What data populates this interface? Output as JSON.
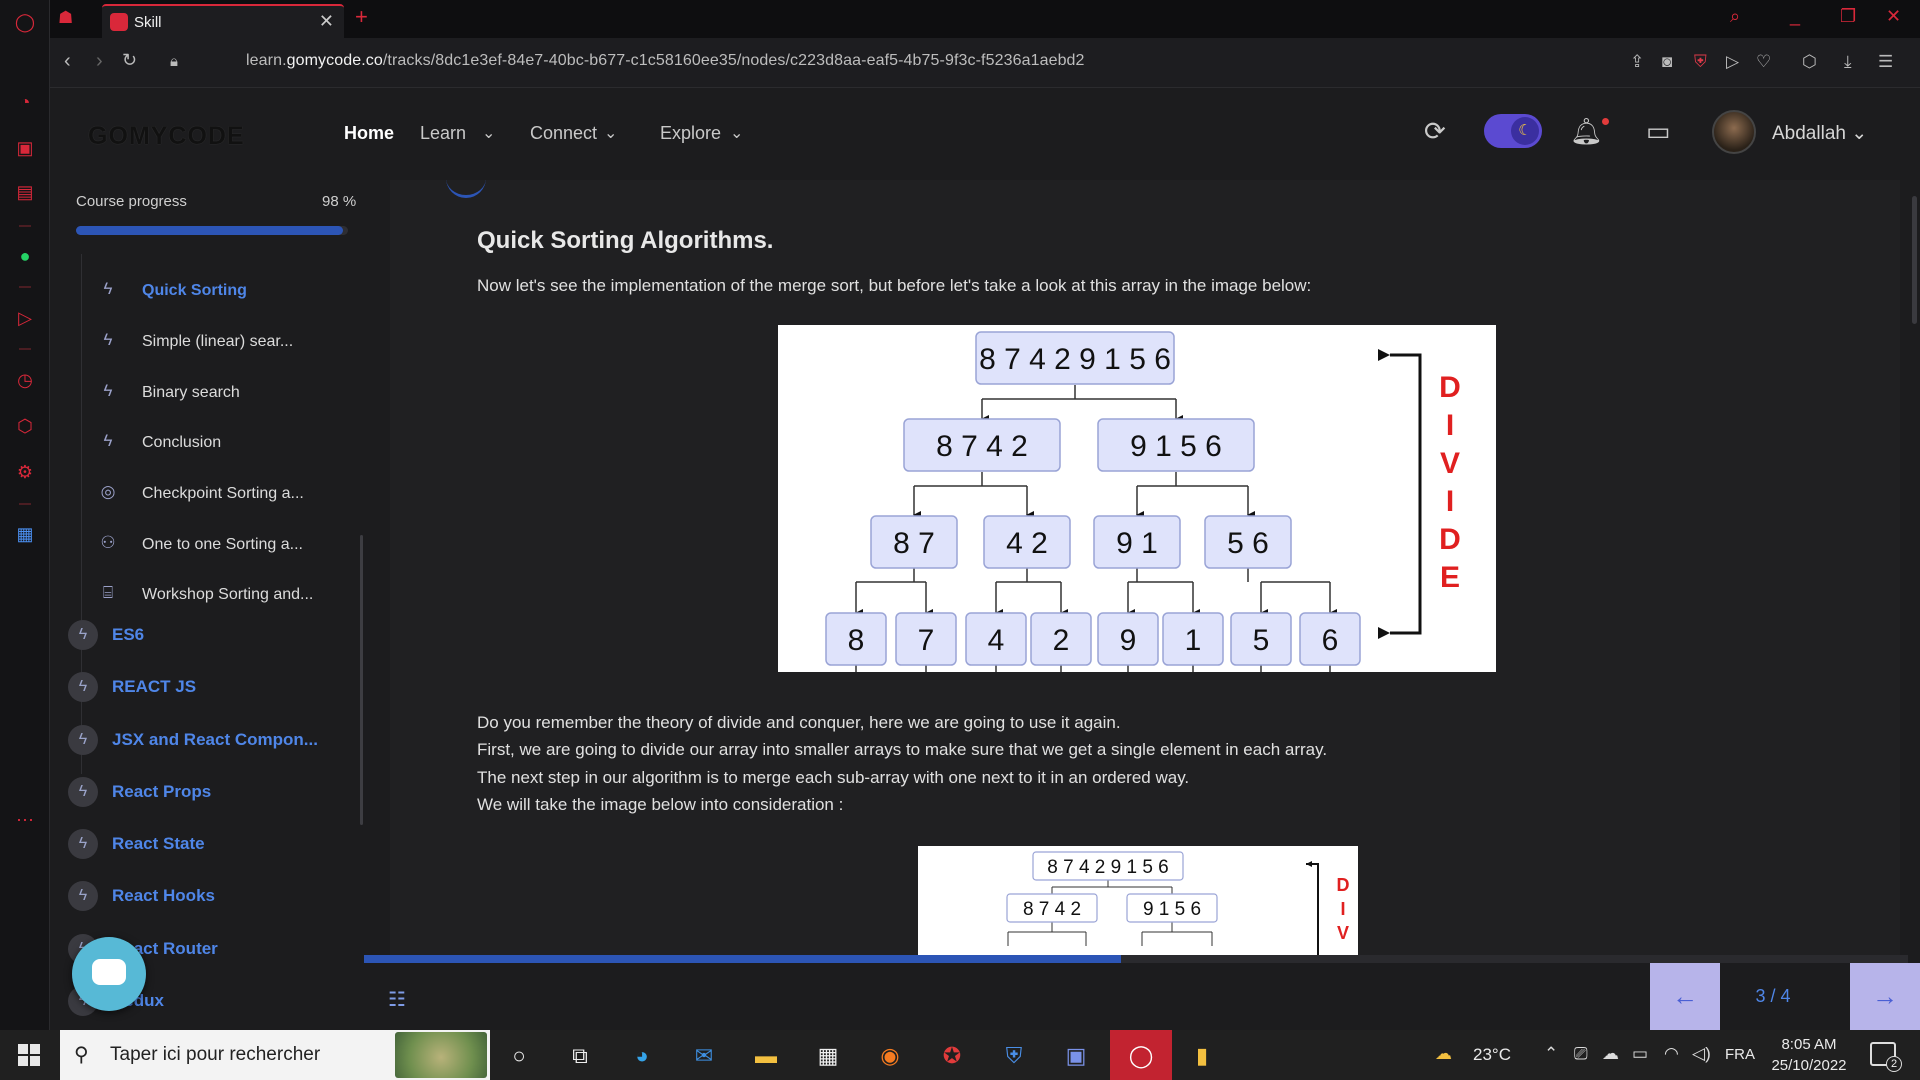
{
  "browser": {
    "tab_title": "Skill",
    "url_prefix": "learn.",
    "url_domain": "gomycode.co",
    "url_path": "/tracks/8dc1e3ef-84e7-40bc-b677-c1c58160ee35/nodes/c223d8aa-eaf5-4b75-9f3c-f5236a1aebd2"
  },
  "header": {
    "logo": "GOMYCODE",
    "nav": [
      {
        "label": "Home",
        "active": true
      },
      {
        "label": "Learn"
      },
      {
        "label": "Connect"
      },
      {
        "label": "Explore"
      }
    ],
    "username": "Abdallah"
  },
  "sidebar": {
    "progress_label": "Course progress",
    "progress_value": "98 %",
    "progress_fraction": 0.98,
    "lessons": [
      {
        "label": "Quick Sorting",
        "icon": "bolt-icon",
        "active": true
      },
      {
        "label": "Simple (linear) sear...",
        "icon": "bolt-icon"
      },
      {
        "label": "Binary search",
        "icon": "bolt-icon"
      },
      {
        "label": "Conclusion",
        "icon": "bolt-icon"
      },
      {
        "label": "Checkpoint Sorting a...",
        "icon": "target-icon"
      },
      {
        "label": "One to one Sorting a...",
        "icon": "people-icon"
      },
      {
        "label": "Workshop Sorting and...",
        "icon": "workshop-icon",
        "alert": true
      }
    ],
    "modules": [
      {
        "label": "ES6"
      },
      {
        "label": "REACT JS"
      },
      {
        "label": "JSX and React Compon..."
      },
      {
        "label": "React Props"
      },
      {
        "label": "React State"
      },
      {
        "label": "React Hooks"
      },
      {
        "label": "React Router"
      },
      {
        "label": "Redux"
      }
    ]
  },
  "content": {
    "title": "Quick Sorting Algorithms.",
    "intro": "Now let's see the implementation of the merge sort, but before let's take a look at this array in the image below:",
    "paragraphs": [
      "Do you remember the theory of divide and conquer, here we are going to use it again.",
      "First, we are going to divide our array into smaller arrays to make sure that we get a single element in each array.",
      "The next step in our algorithm is to merge each sub-array with one next to it in an ordered way.",
      "We will take the image below into consideration :"
    ],
    "figure": {
      "level0": "8 7 4 2 9 1 5 6",
      "level1": [
        "8 7 4 2",
        "9 1 5 6"
      ],
      "level2": [
        "8 7",
        "4 2",
        "9 1",
        "5 6"
      ],
      "level3": [
        "8",
        "7",
        "4",
        "2",
        "9",
        "1",
        "5",
        "6"
      ],
      "side_label": [
        "D",
        "I",
        "V",
        "I",
        "D",
        "E"
      ]
    },
    "figure2": {
      "level0": "8 7 4 2 9 1 5 6",
      "level1": [
        "8 7 4 2",
        "9 1 5 6"
      ],
      "side_label": [
        "D",
        "I",
        "V"
      ]
    },
    "scroll_progress": 0.49
  },
  "pager": {
    "indicator": "3 / 4",
    "prev": "←",
    "next": "→"
  },
  "taskbar": {
    "search_placeholder": "Taper ici pour rechercher",
    "temperature": "23°C",
    "language": "FRA",
    "time": "8:05 AM",
    "date": "25/10/2022",
    "notifications": "2"
  },
  "colors": {
    "accent": "#d9283a",
    "link_blue": "#4f86e8",
    "progress_blue": "#2c55b6",
    "pager_bg": "#b7b4ea"
  }
}
